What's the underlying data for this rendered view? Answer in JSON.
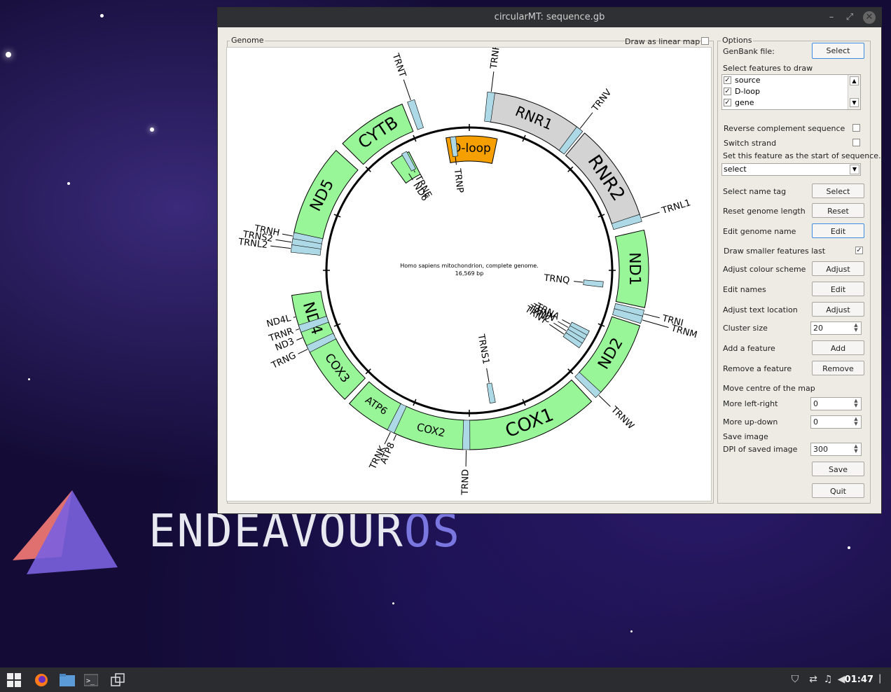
{
  "desktop": {
    "brand_main": "ENDEAVOUR",
    "brand_suffix": "OS"
  },
  "window": {
    "title": "circularMT: sequence.gb",
    "minimize_glyph": "–",
    "maximize_glyph": "⤢",
    "close_glyph": "✕"
  },
  "genome_panel": {
    "group_title": "Genome",
    "linear_label": "Draw as linear map",
    "linear_checked": false,
    "center_title": "Homo sapiens mitochondrion, complete genome.",
    "center_length": "16,569 bp",
    "features": [
      {
        "name": "CYTB",
        "color": "#98f598"
      },
      {
        "name": "D-loop",
        "color": "#f5a000"
      },
      {
        "name": "RNR1",
        "color": "#d3d3d3"
      },
      {
        "name": "RNR2",
        "color": "#d3d3d3"
      },
      {
        "name": "ND1",
        "color": "#98f598"
      },
      {
        "name": "ND2",
        "color": "#98f598"
      },
      {
        "name": "COX1",
        "color": "#98f598"
      },
      {
        "name": "COX2",
        "color": "#98f598"
      },
      {
        "name": "ATP6",
        "color": "#98f598"
      },
      {
        "name": "COX3",
        "color": "#98f598"
      },
      {
        "name": "ND4",
        "color": "#98f598"
      },
      {
        "name": "ND5",
        "color": "#98f598"
      },
      {
        "name": "ND6",
        "color": "#98f598"
      }
    ],
    "trna_labels": [
      "TRNT",
      "TRNF",
      "TRNV",
      "TRNP",
      "TRNE",
      "ND6",
      "TRNL1",
      "TRNI",
      "TRNM",
      "TRNQ",
      "TRNW",
      "TRNA",
      "TRNN",
      "TRNC",
      "TRNY",
      "TRNS1",
      "TRND",
      "TRNK",
      "ATP8",
      "TRNG",
      "ND3",
      "TRNR",
      "ND4L",
      "TRNL2",
      "TRNS2",
      "TRNH"
    ],
    "trna_color": "#add8e6"
  },
  "options": {
    "group_title": "Options",
    "genbank_label": "GenBank file:",
    "genbank_button": "Select",
    "features_label": "Select features to draw",
    "feature_list": [
      {
        "label": "source",
        "checked": true
      },
      {
        "label": "D-loop",
        "checked": true
      },
      {
        "label": "gene",
        "checked": true
      }
    ],
    "reverse_label": "Reverse complement sequence",
    "switch_label": "Switch strand",
    "start_label": "Set this feature as the start of sequence.",
    "start_value": "select",
    "name_tag_label": "Select name tag",
    "name_tag_button": "Select",
    "reset_length_label": "Reset genome length",
    "reset_button": "Reset",
    "edit_name_label": "Edit genome name",
    "edit_name_button": "Edit",
    "smaller_last_label": "Draw smaller features last",
    "smaller_last_checked": true,
    "colour_label": "Adjust colour scheme",
    "colour_button": "Adjust",
    "edit_names_label": "Edit names",
    "edit_names_button": "Edit",
    "text_location_label": "Adjust text location",
    "text_location_button": "Adjust",
    "cluster_label": "Cluster size",
    "cluster_value": "20",
    "add_feature_label": "Add a feature",
    "add_button": "Add",
    "remove_feature_label": "Remove a feature",
    "remove_button": "Remove",
    "move_centre_label": "Move centre of the map",
    "left_right_label": "More left-right",
    "left_right_value": "0",
    "up_down_label": "More up-down",
    "up_down_value": "0",
    "save_image_label": "Save image",
    "dpi_label": "DPI of saved image",
    "dpi_value": "300",
    "save_button": "Save",
    "quit_button": "Quit"
  },
  "taskbar": {
    "clock": "01:47"
  }
}
